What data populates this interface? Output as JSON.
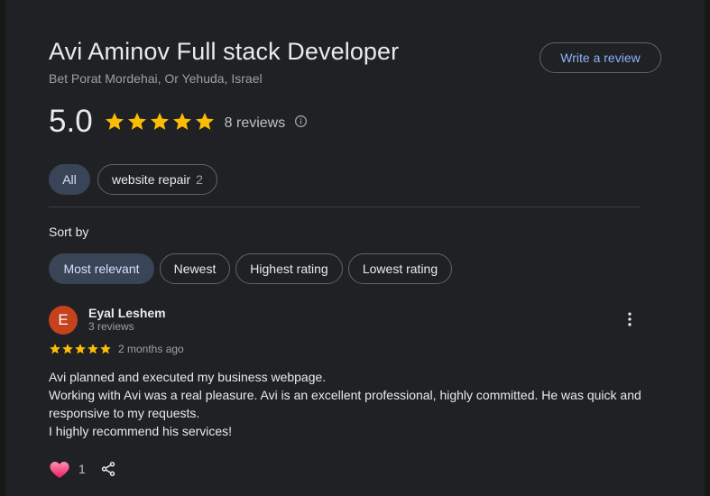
{
  "place": {
    "title": "Avi Aminov Full stack Developer",
    "address": "Bet Porat Mordehai, Or Yehuda, Israel"
  },
  "header": {
    "write_review_label": "Write a review"
  },
  "summary": {
    "rating": "5.0",
    "star_count": 5,
    "reviews_label": "8 reviews",
    "info_icon": "info-icon"
  },
  "filters": {
    "all_label": "All",
    "topic_label": "website repair",
    "topic_count": "2"
  },
  "sort": {
    "label": "Sort by",
    "options": [
      "Most relevant",
      "Newest",
      "Highest rating",
      "Lowest rating"
    ],
    "selected": "Most relevant"
  },
  "review": {
    "avatar_initial": "E",
    "avatar_color": "#c5421c",
    "name": "Eyal Leshem",
    "meta": "3 reviews",
    "stars": 5,
    "time": "2 months ago",
    "lines": [
      "Avi planned and executed my business webpage.",
      "Working with Avi was a real pleasure. Avi is an excellent professional, highly committed. He was quick and responsive to my requests.",
      "I highly recommend his services!"
    ],
    "like_count": "1"
  },
  "colors": {
    "star": "#fbbc04",
    "accent_link": "#8ab4f8",
    "chip_selected_bg": "#394457",
    "heart": "#f06292"
  }
}
